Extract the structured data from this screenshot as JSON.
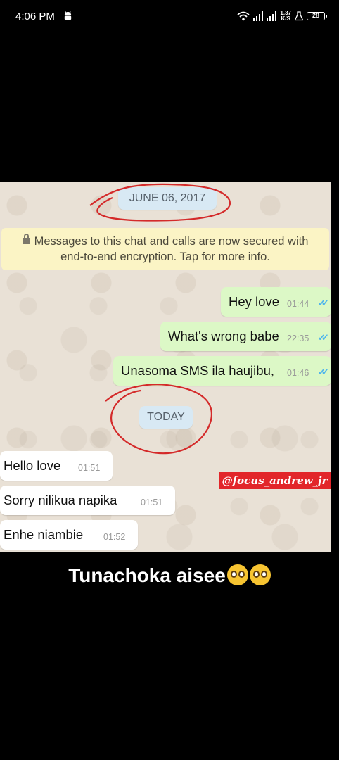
{
  "status_bar": {
    "time": "4:06 PM",
    "speed_value": "1.37",
    "speed_unit": "K/S",
    "battery": "28",
    "icons": [
      "android-icon",
      "wifi-icon",
      "signal-icon",
      "signal-icon",
      "speed-icon",
      "flask-icon",
      "battery-icon"
    ]
  },
  "chat": {
    "date_top": "JUNE 06, 2017",
    "encryption_notice_line1": "Messages to this chat and calls are now secured with",
    "encryption_notice_line2": "end-to-end encryption. Tap for more info.",
    "messages_out": [
      {
        "text": "Hey love",
        "time": "01:44"
      },
      {
        "text": "What's wrong babe",
        "time": "22:35"
      },
      {
        "text": "Unasoma SMS ila haujibu,",
        "time": "01:46"
      }
    ],
    "date_today": "TODAY",
    "messages_in": [
      {
        "text": "Hello love",
        "time": "01:51"
      },
      {
        "text": "Sorry nilikua napika",
        "time": "01:51"
      },
      {
        "text": "Enhe niambie",
        "time": "01:52"
      }
    ],
    "watermark": "@focus_andrew_jr"
  },
  "caption": "Tunachoka aisee",
  "caption_emojis": [
    "pleading-face-emoji",
    "pleading-face-emoji"
  ],
  "colors": {
    "outgoing_bubble": "#dcf8c6",
    "incoming_bubble": "#ffffff",
    "date_pill": "#d8e9f4",
    "encryption_bg": "#fbf4c5",
    "read_ticks": "#4fb5ec",
    "annotation_circle": "#d42a2a",
    "watermark_bg": "#e2262a"
  }
}
